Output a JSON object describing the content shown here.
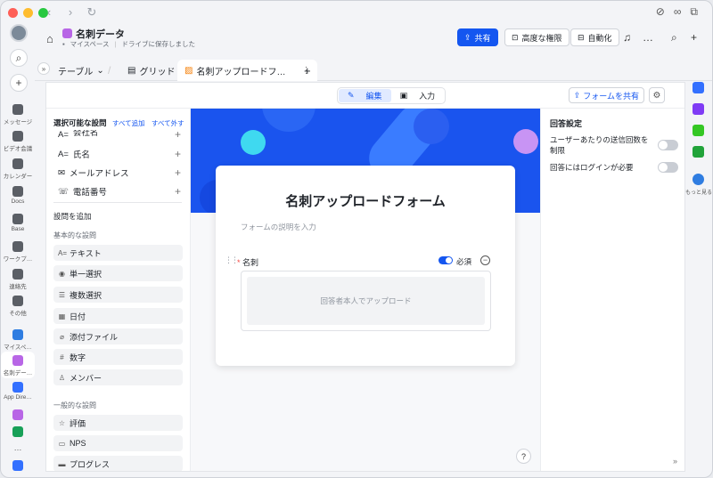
{
  "window": {
    "traffic_colors": [
      "#fe5f57",
      "#febc2e",
      "#28c840"
    ]
  },
  "sidebar": {
    "items": [
      {
        "label": "メッセージ",
        "icon": "chat-icon"
      },
      {
        "label": "ビデオ会議",
        "icon": "video-icon"
      },
      {
        "label": "カレンダー",
        "icon": "calendar-icon"
      },
      {
        "label": "Docs",
        "icon": "docs-icon"
      },
      {
        "label": "Base",
        "icon": "base-icon"
      },
      {
        "label": "ワークプ…",
        "icon": "workplace-icon"
      },
      {
        "label": "連絡先",
        "icon": "contacts-icon"
      },
      {
        "label": "その他",
        "icon": "more-icon"
      },
      {
        "label": "マイスペ…",
        "icon": "myspace-icon"
      },
      {
        "label": "名刺デー…",
        "icon": "base-doc-icon"
      },
      {
        "label": "App Dire…",
        "icon": "app-directory-icon"
      }
    ],
    "bottom_dots": "…"
  },
  "header": {
    "doc_title": "名刺データ",
    "location": "マイスペース",
    "save_status": "ドライブに保存しました",
    "share_label": "共有",
    "permissions_label": "高度な権限",
    "automation_label": "自動化",
    "more": "…"
  },
  "tabs": {
    "table_label": "テーブル",
    "grid_label": "グリッド",
    "form_label": "名刺アップロードフ…",
    "menu": "⋮",
    "add": "+"
  },
  "toolbar": {
    "edit_label": "編集",
    "input_label": "入力",
    "share_form_label": "フォームを共有"
  },
  "left_panel": {
    "title": "選択可能な設問",
    "add_all": "すべて追加",
    "remove_all": "すべて外す",
    "fields": [
      {
        "label": "会社名",
        "icon": "A="
      },
      {
        "label": "氏名",
        "icon": "A="
      },
      {
        "label": "メールアドレス",
        "icon": "✉"
      },
      {
        "label": "電話番号",
        "icon": "☏"
      }
    ],
    "add_section": "設問を追加",
    "basic_group": "基本的な設問",
    "basic_items": [
      {
        "label": "テキスト",
        "icon": "A="
      },
      {
        "label": "単一選択",
        "icon": "◉"
      },
      {
        "label": "複数選択",
        "icon": "☰"
      },
      {
        "label": "日付",
        "icon": "▦"
      },
      {
        "label": "添付ファイル",
        "icon": "⌀"
      },
      {
        "label": "数字",
        "icon": "#"
      },
      {
        "label": "メンバー",
        "icon": "♙"
      }
    ],
    "general_group": "一般的な設問",
    "general_items": [
      {
        "label": "評価",
        "icon": "☆"
      },
      {
        "label": "NPS",
        "icon": "▭"
      },
      {
        "label": "プログレス",
        "icon": "▬"
      }
    ]
  },
  "form": {
    "title": "名刺アップロードフォーム",
    "description_placeholder": "フォームの説明を入力",
    "question_label": "名刺",
    "required_mark": "*",
    "required_label": "必須",
    "upload_placeholder": "回答者本人でアップロード",
    "banner_color": "#1a54ee"
  },
  "right_panel": {
    "title": "回答設定",
    "option1": "ユーザーあたりの送信回数を制限",
    "option2": "回答にはログインが必要"
  },
  "right_strip": {
    "items": [
      {
        "icon": "calendar-app-icon",
        "color": "#3370ff"
      },
      {
        "icon": "tasks-app-icon",
        "color": "#7f3bf5"
      },
      {
        "icon": "docs-app-icon",
        "color": "#34c724"
      },
      {
        "icon": "sheets-app-icon",
        "color": "#21a33a"
      }
    ],
    "more_label": "もっと見る"
  },
  "accent": "#1456f0"
}
